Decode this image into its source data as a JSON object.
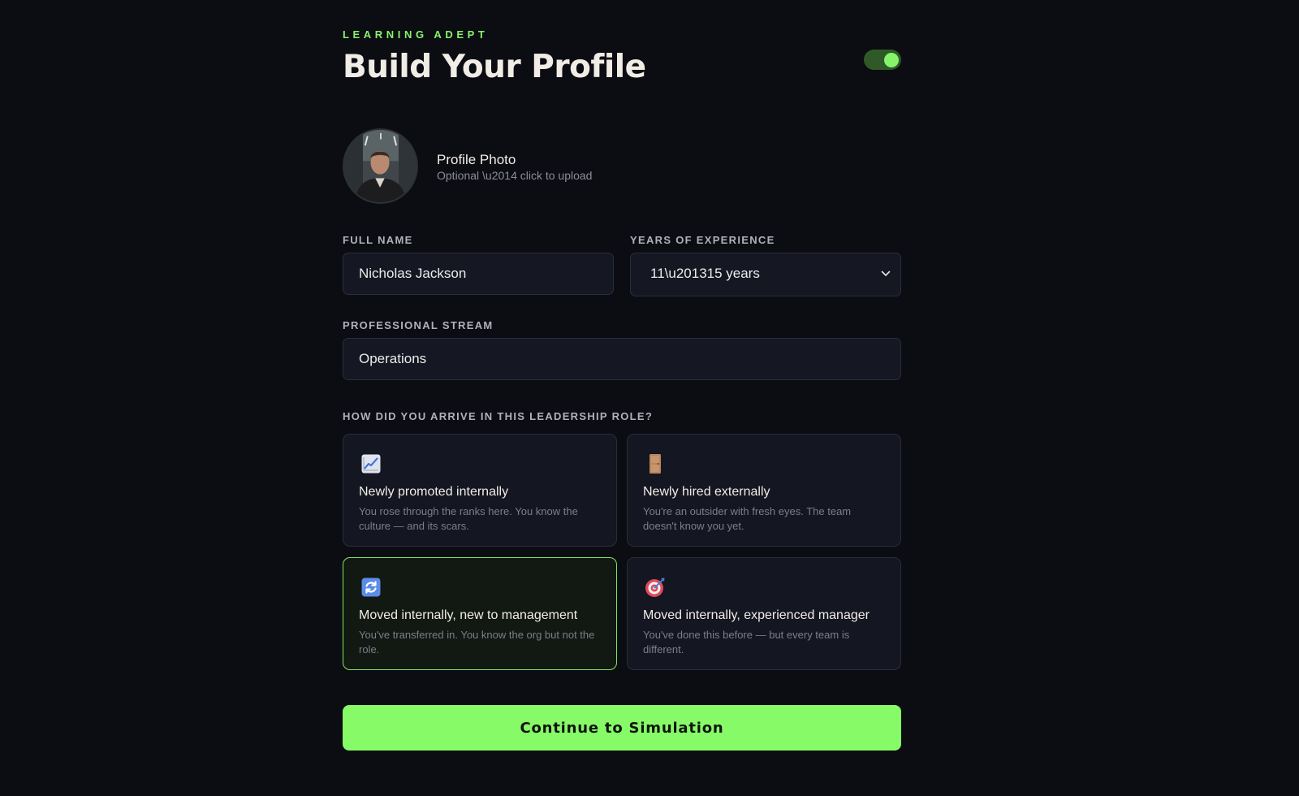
{
  "header": {
    "brand": "LEARNING ADEPT",
    "title": "Build Your Profile",
    "toggle_on": true
  },
  "photo": {
    "title": "Profile Photo",
    "subtitle": "Optional \\u2014 click to upload"
  },
  "form": {
    "full_name": {
      "label": "FULL NAME",
      "value": "Nicholas Jackson"
    },
    "experience": {
      "label": "YEARS OF EXPERIENCE",
      "value": "11\\u201315 years"
    },
    "stream": {
      "label": "PROFESSIONAL STREAM",
      "value": "Operations"
    }
  },
  "arrival": {
    "question": "HOW DID YOU ARRIVE IN THIS LEADERSHIP ROLE?",
    "options": [
      {
        "icon": "chart-increasing-icon",
        "title": "Newly promoted internally",
        "desc": "You rose through the ranks here. You know the culture — and its scars.",
        "selected": false
      },
      {
        "icon": "door-icon",
        "title": "Newly hired externally",
        "desc": "You're an outsider with fresh eyes. The team doesn't know you yet.",
        "selected": false
      },
      {
        "icon": "arrows-cycle-icon",
        "title": "Moved internally, new to management",
        "desc": "You've transferred in. You know the org but not the role.",
        "selected": true
      },
      {
        "icon": "target-icon",
        "title": "Moved internally, experienced manager",
        "desc": "You've done this before — but every team is different.",
        "selected": false
      }
    ]
  },
  "cta": {
    "label": "Continue to Simulation"
  },
  "colors": {
    "accent": "#86f46a",
    "background": "#0c0d12",
    "card": "#141621",
    "border": "#2a2d3b"
  }
}
